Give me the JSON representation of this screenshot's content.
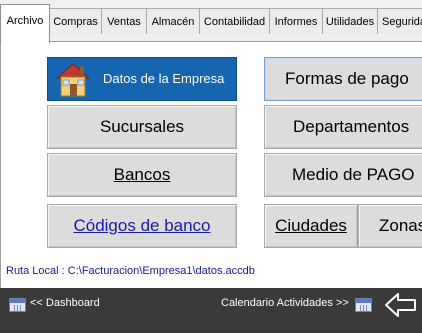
{
  "tabs": [
    {
      "label": "Archivo",
      "active": true
    },
    {
      "label": "Compras"
    },
    {
      "label": "Ventas"
    },
    {
      "label": "Almacén"
    },
    {
      "label": "Contabilidad"
    },
    {
      "label": "Informes"
    },
    {
      "label": "Utilidades"
    },
    {
      "label": "Seguridad"
    }
  ],
  "buttons": {
    "datos_empresa": "Datos de la Empresa",
    "sucursales": "Sucursales",
    "bancos": "Bancos",
    "codigos_banco": "Códigos de banco",
    "formas_pago": "Formas de pago",
    "departamentos": "Departamentos",
    "medio_pago": "Medio de PAGO",
    "ciudades": "Ciudades",
    "zonas": "Zonas"
  },
  "ruta_local": "Ruta Local : C:\\Facturacion\\Empresa1\\datos.accdb",
  "bottom": {
    "dashboard": "<< Dashboard",
    "calendario": "Calendario Actividades >>"
  },
  "icons": {
    "empresa": "house-icon",
    "dashboard": "calendar-icon",
    "calendario": "calendar-icon",
    "arrow": "arrow-left-icon"
  },
  "colors": {
    "accent_button": "#1565b0",
    "bottom_bar": "#3a3a3a",
    "link_text": "#1a1aa8"
  }
}
